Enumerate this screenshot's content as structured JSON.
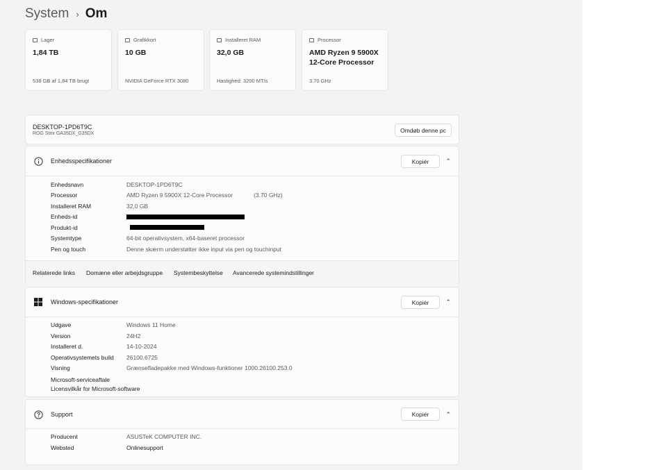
{
  "breadcrumb": {
    "parent": "System",
    "separator": "›",
    "current": "Om"
  },
  "tiles": [
    {
      "label": "Lager",
      "value": "1,84 TB",
      "sub": "538 GB af 1,84 TB brugt",
      "icon": "storage-icon"
    },
    {
      "label": "Grafikkort",
      "value": "10 GB",
      "sub": "NVIDIA GeForce RTX 3080",
      "icon": "gpu-icon"
    },
    {
      "label": "Installeret RAM",
      "value": "32,0 GB",
      "sub": "Hastighed: 3200 MT/s",
      "icon": "ram-icon"
    },
    {
      "label": "Processor",
      "value": "AMD Ryzen 9 5900X 12-Core Processor",
      "sub": "3.70 GHz",
      "icon": "cpu-icon"
    }
  ],
  "pc": {
    "name": "DESKTOP-1PD6T9C",
    "model": "ROG Strix GA35DX_G35DX",
    "rename_button": "Omdøb denne pc"
  },
  "device_specs": {
    "title": "Enhedsspecifikationer",
    "copy_button": "Kopiér",
    "icon": "info-icon",
    "rows": [
      {
        "key": "Enhedsnavn",
        "value": "DESKTOP-1PD6T9C"
      },
      {
        "key": "Processor",
        "value": "AMD Ryzen 9 5900X 12-Core Processor",
        "extra": "(3.70 GHz)"
      },
      {
        "key": "Installeret RAM",
        "value": "32,0 GB"
      },
      {
        "key": "Enheds-id",
        "value": ""
      },
      {
        "key": "Produkt-id",
        "value": ""
      },
      {
        "key": "Systemtype",
        "value": "64-bit operativsystem, x64-baseret processor"
      },
      {
        "key": "Pen og touch",
        "value": "Denne skærm understøtter ikke input via pen og touchinput"
      }
    ]
  },
  "related_links": {
    "title": "Relaterede links",
    "items": [
      "Domæne eller arbejdsgruppe",
      "Systembeskyttelse",
      "Avancerede systemindstillinger"
    ]
  },
  "windows_specs": {
    "title": "Windows-specifikationer",
    "copy_button": "Kopiér",
    "icon": "windows-logo-icon",
    "rows": [
      {
        "key": "Udgave",
        "value": "Windows 11 Home"
      },
      {
        "key": "Version",
        "value": "24H2"
      },
      {
        "key": "Installeret d.",
        "value": "14-10-2024"
      },
      {
        "key": "Operativsystemets build",
        "value": "26100.6725"
      },
      {
        "key": "Visning",
        "value": "Grænsefladepakke med Windows-funktioner 1000.26100.253.0"
      }
    ],
    "links": [
      "Microsoft-serviceaftale",
      "Licensvilkår for Microsoft-software"
    ]
  },
  "support": {
    "title": "Support",
    "copy_button": "Kopiér",
    "icon": "help-icon",
    "rows": [
      {
        "key": "Producent",
        "value": "ASUSTeK COMPUTER INC."
      },
      {
        "key": "Websted",
        "value": "Onlinesupport"
      }
    ]
  }
}
